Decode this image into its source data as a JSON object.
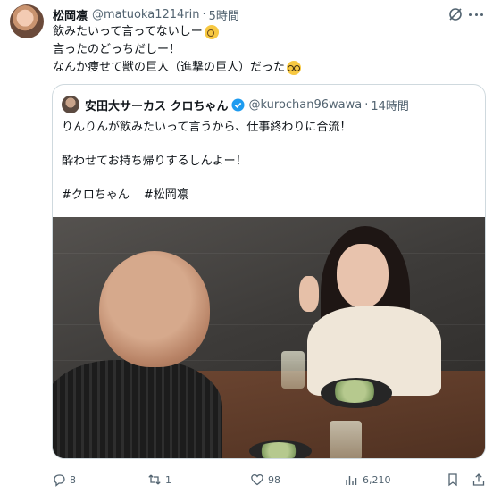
{
  "tweet": {
    "author_name": "松岡凛",
    "author_handle": "@matuoka1214rin",
    "dot": "·",
    "time": "5時間",
    "lines": [
      "飲みたいって言ってないしー",
      "言ったのどっちだしー！",
      "なんか痩せて獣の巨人（進撃の巨人）だった"
    ]
  },
  "quote": {
    "author_name": "安田大サーカス クロちゃん",
    "author_handle": "@kurochan96wawa",
    "dot": "·",
    "time": "14時間",
    "line1": "りんりんが飲みたいって言うから、仕事終わりに合流！",
    "line2": "酔わせてお持ち帰りするしんよー！",
    "hashtags": [
      "#クロちゃん",
      "#松岡凛"
    ]
  },
  "actions": {
    "replies": "8",
    "reposts": "1",
    "likes": "98",
    "views": "6,210"
  },
  "colors": {
    "text": "#0f1419",
    "secondary": "#536471",
    "border": "#cfd9de",
    "verified": "#1d9bf0"
  },
  "icons": [
    "grok-icon",
    "more-icon",
    "verified-badge-icon",
    "reply-icon",
    "repost-icon",
    "like-icon",
    "views-icon",
    "bookmark-icon",
    "share-icon"
  ]
}
